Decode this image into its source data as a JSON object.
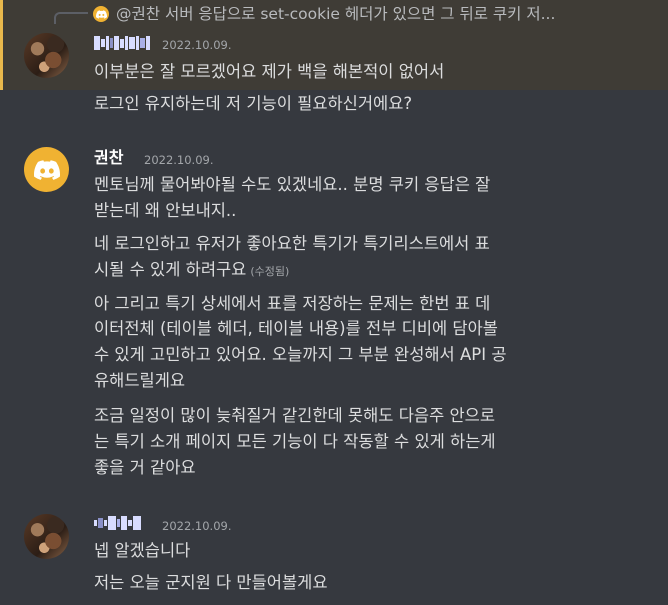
{
  "reply": {
    "text": "@권찬 서버 응답으로 set-cookie 헤더가 있으면 그 뒤로 쿠키 저..."
  },
  "messages": [
    {
      "timestamp": "2022.10.09.",
      "lines": [
        "이부분은 잘 모르겠어요 제가 백을 해본적이 없어서",
        "로그인 유지하는데 저 기능이 필요하신거에요?"
      ]
    },
    {
      "author": "권찬",
      "timestamp": "2022.10.09.",
      "lines": [
        "멘토님께 물어봐야될 수도 있겠네요.. 분명 쿠키 응답은 잘",
        "받는데 왜 안보내지..",
        "네 로그인하고 유저가 좋아요한 특기가 특기리스트에서 표",
        "시될 수 있게 하려구요",
        "아 그리고 특기 상세에서 표를 저장하는 문제는 한번 표 데",
        "이터전체 (테이블 헤더, 테이블 내용)를 전부 디비에 담아볼",
        "수 있게 고민하고 있어요. 오늘까지 그 부분 완성해서 API 공",
        "유해드릴게요",
        "조금 일정이 많이 늦춰질거 같긴한데 못해도 다음주 안으로",
        "는 특기 소개 페이지 모든 기능이 다 작동할 수 있게 하는게",
        "좋을 거 같아요"
      ],
      "edited_label": "(수정됨)"
    },
    {
      "timestamp": "2022.10.09.",
      "lines": [
        "넵 알겠습니다",
        "저는 오늘 군지원 다 만들어볼게요"
      ]
    }
  ],
  "colors": {
    "background": "#36393f",
    "reply_highlight": "#3f3c36",
    "mention_bar": "#e8b84c",
    "discord_avatar": "#f0b232"
  },
  "icons": {
    "reply_avatar": "discord-logo-icon",
    "avatar_2": "discord-logo-icon"
  }
}
